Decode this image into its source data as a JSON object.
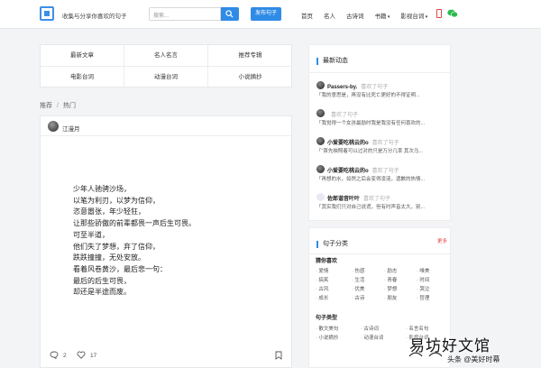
{
  "header": {
    "tagline": "收集与分享你喜欢的句子",
    "search_placeholder": "搜索...",
    "publish_label": "发布句子",
    "nav": [
      "首页",
      "名人",
      "古诗词",
      "书籍",
      "影视台词"
    ]
  },
  "categories": [
    "最新文章",
    "名人名言",
    "推荐专辑",
    "电影台词",
    "动漫台词",
    "小说摘抄"
  ],
  "breadcrumb": {
    "root": "推荐",
    "current": "热门"
  },
  "post": {
    "author": "江漫月",
    "poem": [
      "少年人驰骋沙场，",
      "以笔为利刃，以梦为信仰，",
      "恣意嚣张，年少轻狂，",
      "让那些骄傲的前辈都畏一声后生可畏。",
      "可至半道，",
      "他们失了梦想，弃了信仰，",
      "跌跌撞撞，无处安放。",
      "看着风卷黄沙，最后悲一句：",
      "最后的后生可畏，",
      "却还是半途而废。"
    ],
    "comments": "2",
    "likes": "17"
  },
  "sidebar": {
    "activity_title": "最新动态",
    "activities": [
      {
        "name": "Passers-by.",
        "verb": "喜欢了句子",
        "text": "「我的意思是，再没有比死亡更好的不得证明..."
      },
      {
        "name": "",
        "verb": "喜欢了句子",
        "text": "「我觉得一个女孩最励时我是我没有任何喜欢的..."
      },
      {
        "name": "小爱要吃桃云的o",
        "verb": "喜欢了句子",
        "text": "「“首先映照着可以过对的只是万分几率 其次马..."
      },
      {
        "name": "小爱要吃桃云的o",
        "verb": "喜欢了句子",
        "text": "「再想的水，如然之后会变得凌涟，遗歉的热情..."
      },
      {
        "name": "佐郎谐音叶叶",
        "verb": "喜欢了句子",
        "text": "「其实我们只对自己说谎，但有时声音太大，别..."
      }
    ],
    "category_title": "句子分类",
    "more_label": "更多",
    "mood_title": "猜你喜欢",
    "mood_tags": [
      "爱情",
      "伤感",
      "励志",
      "唯美",
      "搞笑",
      "生活",
      "青春",
      "时间",
      "古风",
      "优美",
      "梦想",
      "哭泣",
      "成长",
      "古诗",
      "朋友",
      "哲理"
    ],
    "type_title": "句子类型",
    "type_tags": [
      "散文美句",
      "古诗词",
      "名言名句",
      "小说摘抄",
      "动漫台词",
      "影视台词"
    ]
  },
  "watermark": {
    "big": "易坊好文馆",
    "small": "头条 @美好时幕"
  }
}
